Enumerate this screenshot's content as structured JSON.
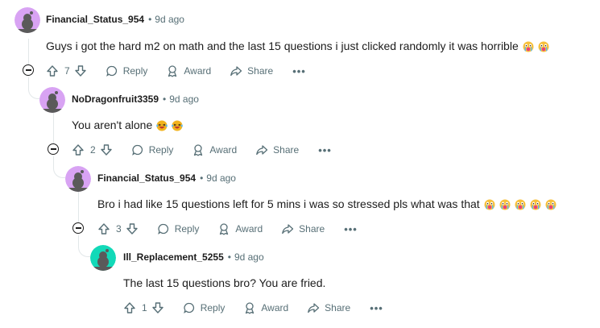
{
  "comments": [
    {
      "username": "Financial_Status_954",
      "time": "9d ago",
      "text": "Guys i got the hard m2 on math and the last 15 questions i just clicked randomly it was horrible",
      "emoji": [
        "crying-face",
        "crying-face"
      ],
      "votes": "7",
      "reply_label": "Reply",
      "award_label": "Award",
      "share_label": "Share",
      "avatar_color": "#d8a3f3",
      "emoji_color": "#e8407a"
    },
    {
      "username": "NoDragonfruit3359",
      "time": "9d ago",
      "text": "You aren't alone",
      "emoji": [
        "laughing-face",
        "laughing-face"
      ],
      "votes": "2",
      "reply_label": "Reply",
      "award_label": "Award",
      "share_label": "Share",
      "avatar_color": "#d8a3f3",
      "emoji_color": "#f2b31c"
    },
    {
      "username": "Financial_Status_954",
      "time": "9d ago",
      "text": "Bro i had like 15 questions left for 5 mins i was so stressed pls what was that",
      "emoji": [
        "crying-face",
        "crying-face",
        "crying-face",
        "crying-face",
        "crying-face"
      ],
      "votes": "3",
      "reply_label": "Reply",
      "award_label": "Award",
      "share_label": "Share",
      "avatar_color": "#d8a3f3",
      "emoji_color": "#e8407a"
    },
    {
      "username": "Ill_Replacement_5255",
      "time": "9d ago",
      "text": "The last 15 questions bro? You are fried.",
      "emoji": [],
      "votes": "1",
      "reply_label": "Reply",
      "award_label": "Award",
      "share_label": "Share",
      "avatar_color": "#12d9b8",
      "emoji_color": ""
    }
  ],
  "separator": "•",
  "more_label": "•••"
}
